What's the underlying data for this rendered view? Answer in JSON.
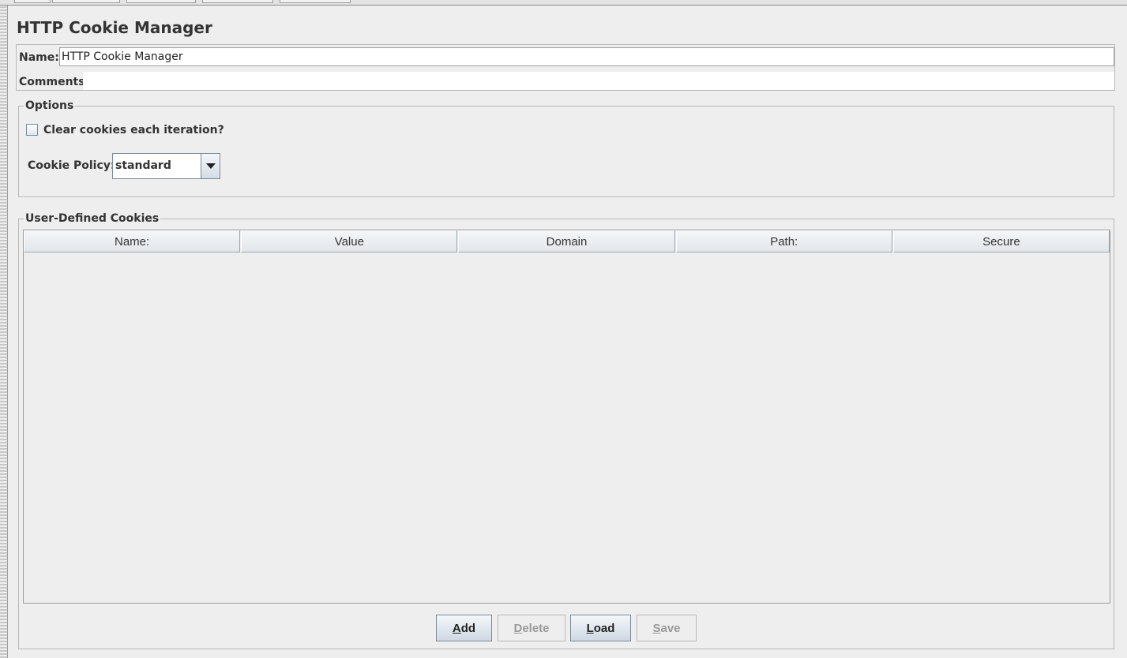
{
  "panel": {
    "title": "HTTP Cookie Manager",
    "name_label": "Name:",
    "name_value": "HTTP Cookie Manager",
    "comments_label": "Comments:",
    "comments_value": ""
  },
  "options": {
    "legend": "Options",
    "clear_cookies_label": "Clear cookies each iteration?",
    "clear_cookies_checked": false,
    "cookie_policy_label": "Cookie Policy:",
    "cookie_policy_value": "standard"
  },
  "cookies": {
    "legend": "User-Defined Cookies",
    "columns": [
      "Name:",
      "Value",
      "Domain",
      "Path:",
      "Secure"
    ],
    "rows": []
  },
  "buttons": {
    "add": {
      "mnemonic": "A",
      "rest": "dd",
      "enabled": true
    },
    "delete": {
      "mnemonic": "D",
      "rest": "elete",
      "enabled": false
    },
    "load": {
      "mnemonic": "L",
      "rest": "oad",
      "enabled": true
    },
    "save": {
      "mnemonic": "S",
      "rest": "ave",
      "enabled": false
    }
  },
  "icons": {
    "combo_arrow": "chevron-down-icon"
  }
}
